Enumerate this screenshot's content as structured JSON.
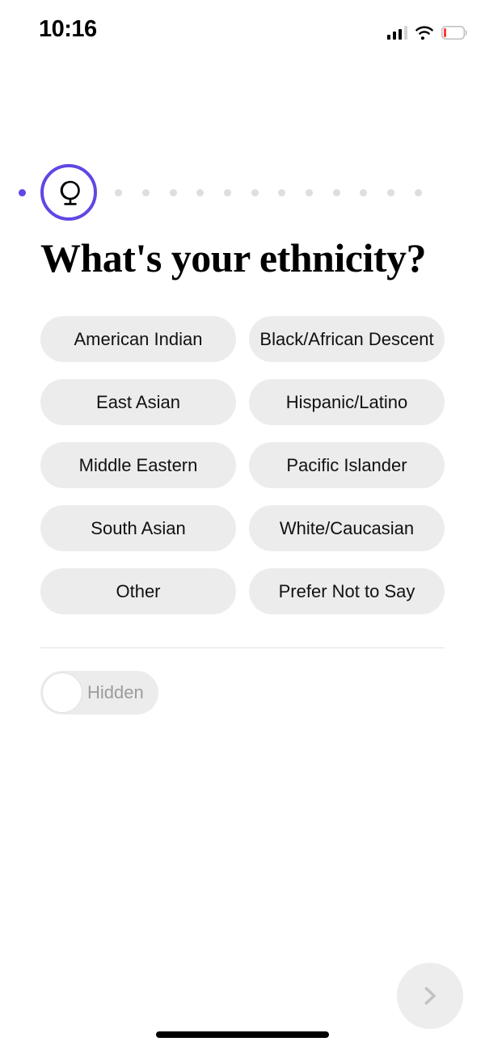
{
  "status_bar": {
    "time": "10:16",
    "cellular_icon": "cellular-bars-icon",
    "wifi_icon": "wifi-icon",
    "battery_icon": "battery-low-icon",
    "battery_color": "#ff3b30"
  },
  "progress": {
    "accent_color": "#6246e5",
    "inactive_color": "#dedede",
    "completed_dots": 1,
    "active_step_icon": "globe-icon",
    "remaining_dots": 12
  },
  "main": {
    "title": "What's your ethnicity?",
    "options": [
      {
        "label": "American Indian"
      },
      {
        "label": "Black/African Descent"
      },
      {
        "label": "East Asian"
      },
      {
        "label": "Hispanic/Latino"
      },
      {
        "label": "Middle Eastern"
      },
      {
        "label": "Pacific Islander"
      },
      {
        "label": "South Asian"
      },
      {
        "label": "White/Caucasian"
      },
      {
        "label": "Other"
      },
      {
        "label": "Prefer Not to Say"
      }
    ],
    "chip_background": "#ececec"
  },
  "hidden_toggle": {
    "label": "Hidden",
    "state": "off"
  },
  "next_button": {
    "icon": "chevron-right-icon",
    "state": "disabled"
  }
}
